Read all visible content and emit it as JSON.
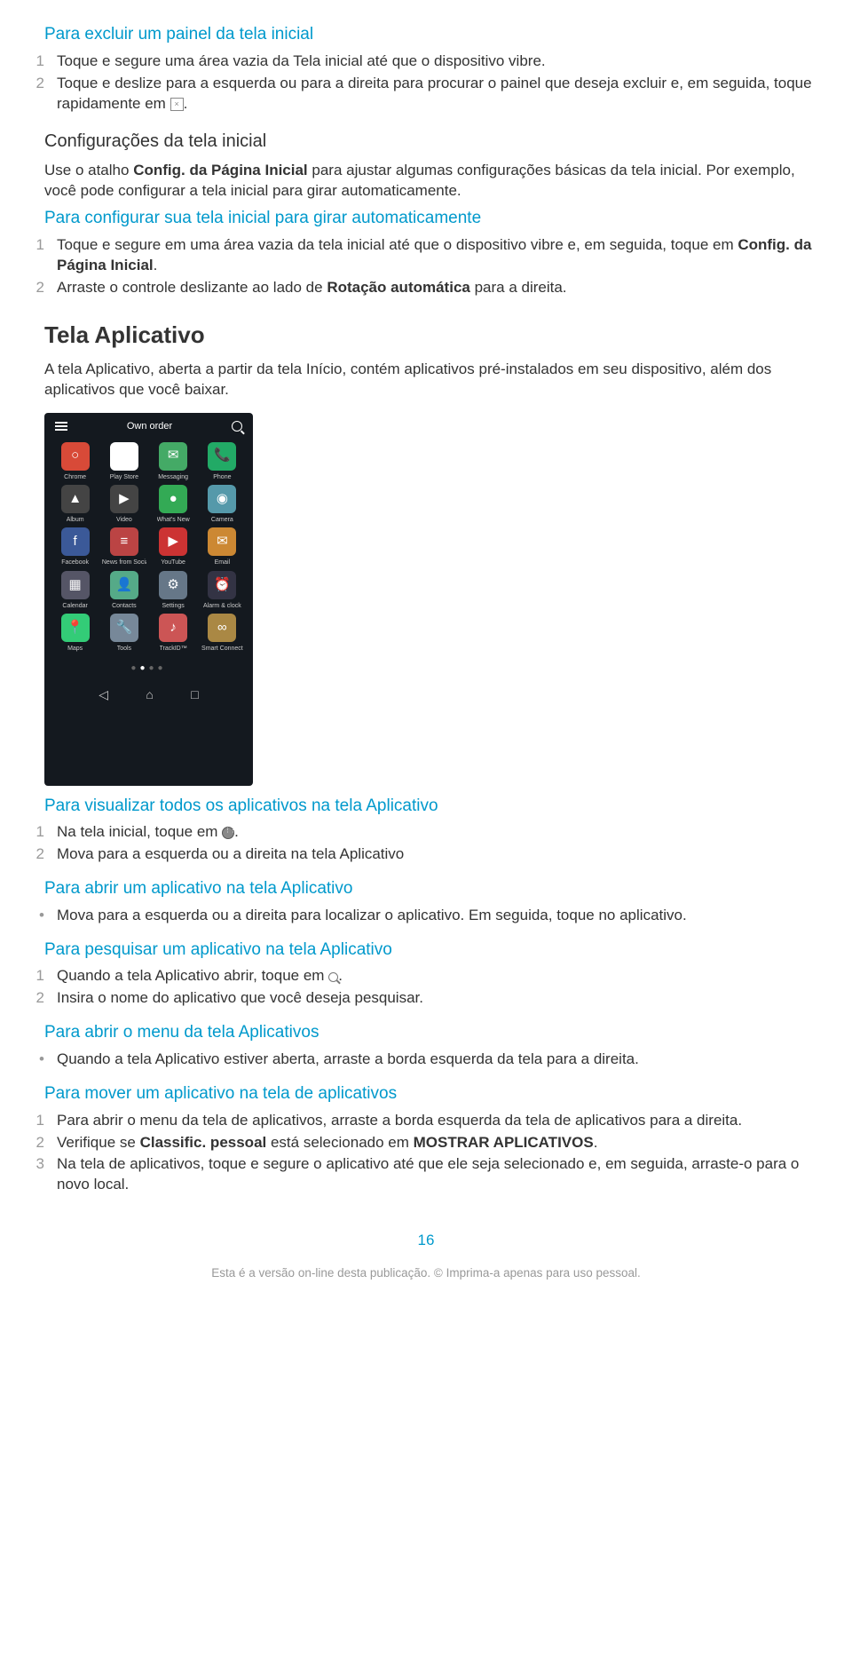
{
  "s1": {
    "h": "Para excluir um painel da tela inicial",
    "i1": "Toque e segure uma área vazia da Tela inicial até que o dispositivo vibre.",
    "i2": "Toque e deslize para a esquerda ou para a direita para procurar o painel que deseja excluir e, em seguida, toque rapidamente em "
  },
  "s2": {
    "h": "Configurações da tela inicial",
    "p_a": "Use o atalho ",
    "p_b": "Config. da Página Inicial",
    "p_c": " para ajustar algumas configurações básicas da tela inicial. Por exemplo, você pode configurar a tela inicial para girar automaticamente."
  },
  "s3": {
    "h": "Para configurar sua tela inicial para girar automaticamente",
    "i1a": "Toque e segure em uma área vazia da tela inicial até que o dispositivo vibre e, em seguida, toque em ",
    "i1b": "Config. da Página Inicial",
    "i2a": "Arraste o controle deslizante ao lado de ",
    "i2b": "Rotação automática",
    "i2c": " para a direita."
  },
  "s4": {
    "h": "Tela Aplicativo",
    "p": "A tela Aplicativo, aberta a partir da tela Início, contém aplicativos pré-instalados em seu dispositivo, além dos aplicativos que você baixar."
  },
  "phone": {
    "title": "Own order",
    "apps": [
      [
        "#d84a38",
        "○",
        "Chrome"
      ],
      [
        "#fff",
        "▶",
        "Play Store"
      ],
      [
        "#4a6",
        "✉",
        "Messaging"
      ],
      [
        "#2a6",
        "📞",
        "Phone"
      ],
      [
        "#444",
        "▲",
        "Album"
      ],
      [
        "#444",
        "▶",
        "Video"
      ],
      [
        "#3a5",
        "●",
        "What's New"
      ],
      [
        "#59a",
        "◉",
        "Camera"
      ],
      [
        "#3b5998",
        "f",
        "Facebook"
      ],
      [
        "#b44",
        "≡",
        "News from Socialife"
      ],
      [
        "#c33",
        "▶",
        "YouTube"
      ],
      [
        "#c83",
        "✉",
        "Email"
      ],
      [
        "#556",
        "▦",
        "Calendar"
      ],
      [
        "#5a8",
        "👤",
        "Contacts"
      ],
      [
        "#678",
        "⚙",
        "Settings"
      ],
      [
        "#334",
        "⏰",
        "Alarm & clock"
      ],
      [
        "#3c7",
        "📍",
        "Maps"
      ],
      [
        "#789",
        "🔧",
        "Tools"
      ],
      [
        "#c55",
        "♪",
        "TrackID™"
      ],
      [
        "#a84",
        "∞",
        "Smart Connect"
      ]
    ]
  },
  "s5": {
    "h": "Para visualizar todos os aplicativos na tela Aplicativo",
    "i1": "Na tela inicial, toque em ",
    "i2": "Mova para a esquerda ou a direita na tela Aplicativo"
  },
  "s6": {
    "h": "Para abrir um aplicativo na tela Aplicativo",
    "b": "Mova para a esquerda ou a direita para localizar o aplicativo. Em seguida, toque no aplicativo."
  },
  "s7": {
    "h": "Para pesquisar um aplicativo na tela Aplicativo",
    "i1": "Quando a tela Aplicativo abrir, toque em ",
    "i2": "Insira o nome do aplicativo que você deseja pesquisar."
  },
  "s8": {
    "h": "Para abrir o menu da tela Aplicativos",
    "b": "Quando a tela Aplicativo estiver aberta, arraste a borda esquerda da tela para a direita."
  },
  "s9": {
    "h": "Para mover um aplicativo na tela de aplicativos",
    "i1": "Para abrir o menu da tela de aplicativos, arraste a borda esquerda da tela de aplicativos para a direita.",
    "i2a": "Verifique se ",
    "i2b": "Classific. pessoal",
    "i2c": " está selecionado em ",
    "i2d": "MOSTRAR APLICATIVOS",
    "i3": "Na tela de aplicativos, toque e segure o aplicativo até que ele seja selecionado e, em seguida, arraste-o para o novo local."
  },
  "page": "16",
  "footer": "Esta é a versão on-line desta publicação. © Imprima-a apenas para uso pessoal."
}
